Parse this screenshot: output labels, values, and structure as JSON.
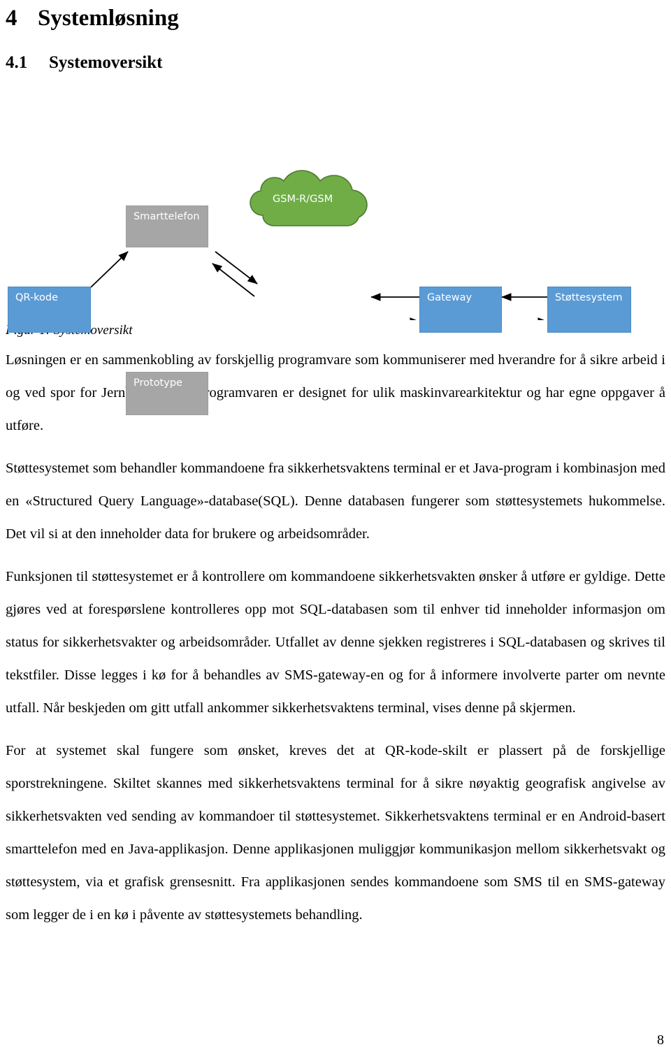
{
  "headings": {
    "chapter_number": "4",
    "chapter_title": "Systemløsning",
    "section_number": "4.1",
    "section_title": "Systemoversikt"
  },
  "figure": {
    "caption": "Figur 1: Systemoversikt",
    "nodes": {
      "smarttelefon": "Smarttelefon",
      "qr_kode": "QR-kode",
      "prototype": "Prototype",
      "gsm": "GSM-R/GSM",
      "gateway": "Gateway",
      "stottesystem": "Støttesystem"
    },
    "colors": {
      "gray_fill": "#a6a6a6",
      "blue_fill": "#5b9bd5",
      "cloud_fill": "#70ad47",
      "cloud_stroke": "#4e7a2f",
      "arrow": "#000000"
    }
  },
  "paragraphs": [
    "Løsningen er en sammenkobling av forskjellig programvare som kommuniserer med hverandre for å sikre arbeid i og ved spor for Jernbaneverket. Programvaren er designet for ulik maskinvarearkitektur og har egne oppgaver å utføre.",
    "Støttesystemet som behandler kommandoene fra sikkerhetsvaktens terminal er et Java-program i kombinasjon med en «Structured Query Language»-database(SQL). Denne databasen fungerer som støttesystemets hukommelse. Det vil si at den inneholder data for brukere og arbeidsområder.",
    "Funksjonen til støttesystemet er å kontrollere om kommandoene sikkerhetsvakten ønsker å utføre er gyldige. Dette gjøres ved at forespørslene kontrolleres opp mot SQL-databasen som til enhver tid inneholder informasjon om status for sikkerhetsvakter og arbeidsområder. Utfallet av denne sjekken registreres i SQL-databasen og skrives til tekstfiler. Disse legges i kø for å behandles av SMS-gateway-en og for å informere involverte parter om nevnte utfall. Når beskjeden om gitt utfall ankommer sikkerhetsvaktens terminal, vises denne på skjermen.",
    "For at systemet skal fungere som ønsket, kreves det at QR-kode-skilt er plassert på de forskjellige sporstrekningene. Skiltet skannes med sikkerhetsvaktens terminal for å sikre nøyaktig geografisk angivelse av sikkerhetsvakten ved sending av kommandoer til støttesystemet. Sikkerhetsvaktens terminal er en Android-basert smarttelefon med en Java-applikasjon. Denne applikasjonen muliggjør kommunikasjon mellom sikkerhetsvakt og støttesystem, via et grafisk grensesnitt. Fra applikasjonen sendes kommandoene som SMS til en SMS-gateway som legger de i en kø i påvente av støttesystemets behandling."
  ],
  "page_number": "8"
}
